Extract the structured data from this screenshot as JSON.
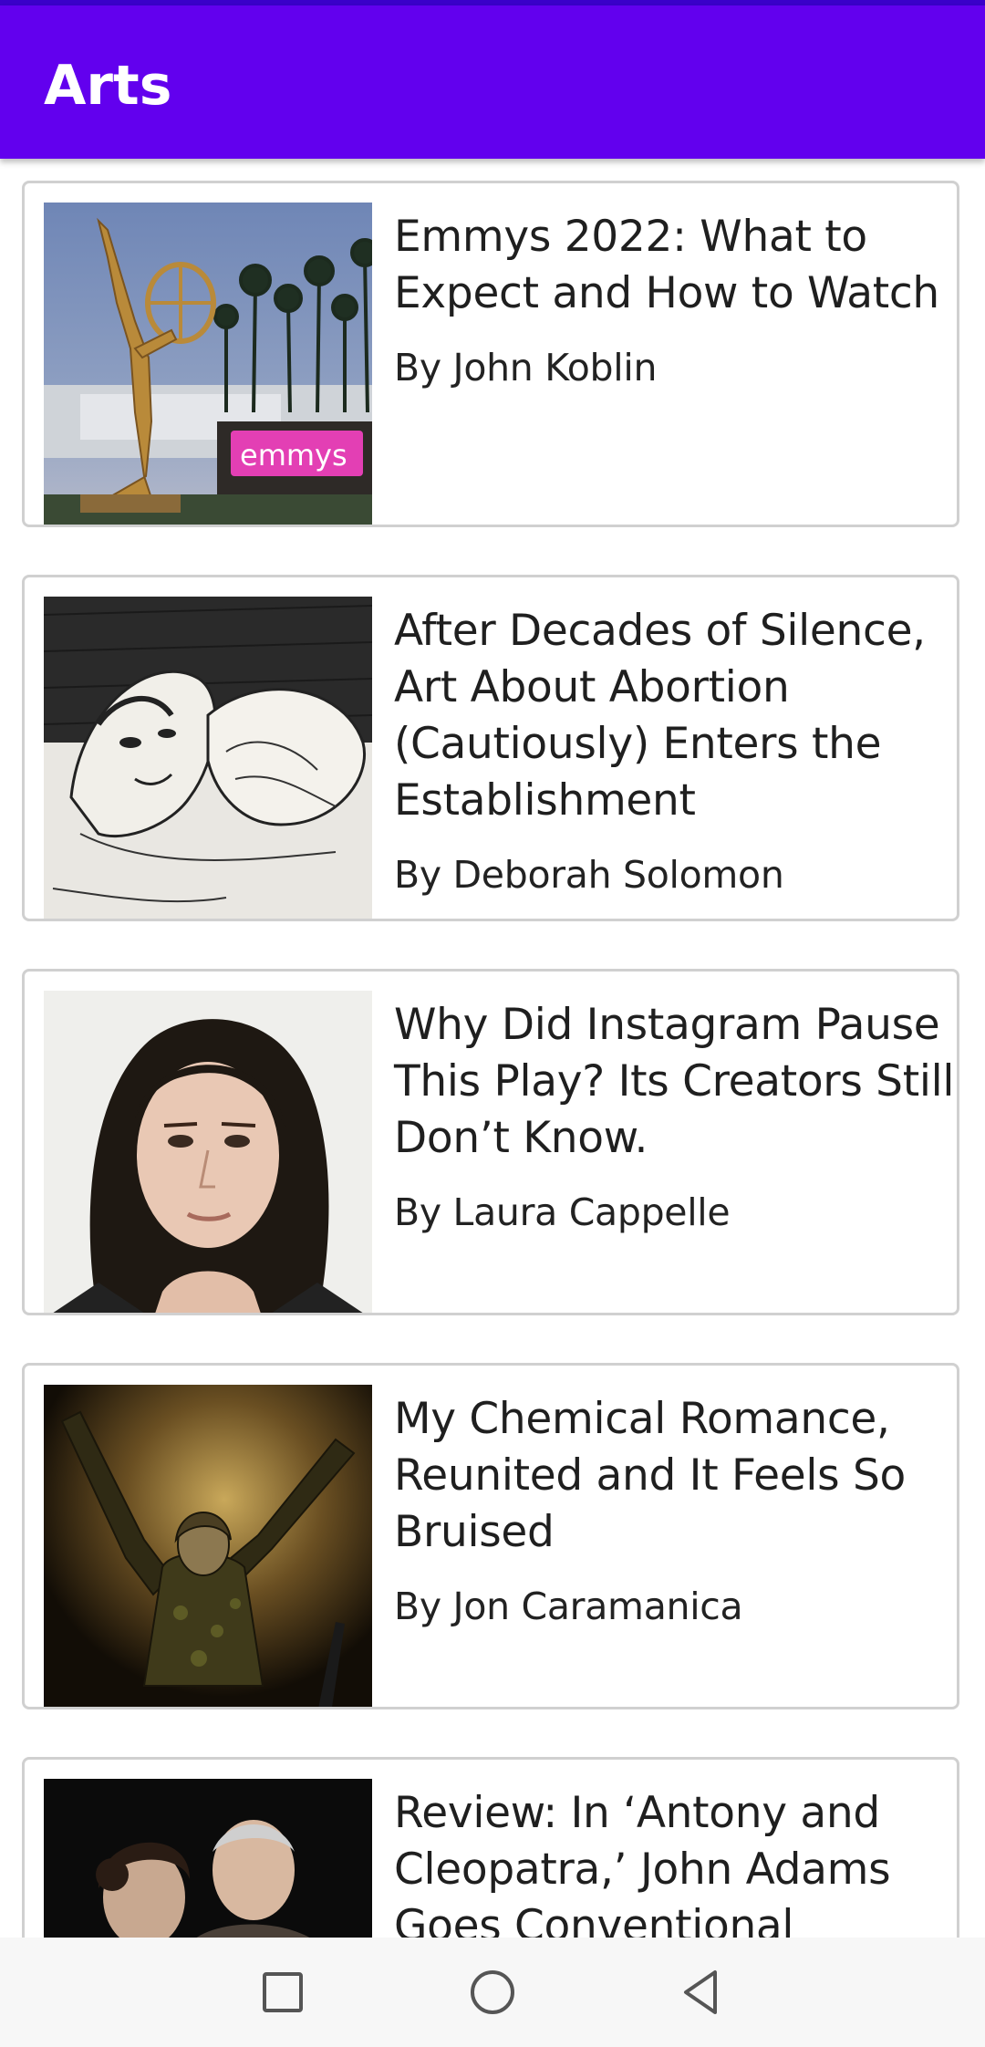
{
  "app_bar": {
    "title": "Arts",
    "color": "#6200ee"
  },
  "articles": [
    {
      "title": "Emmys 2022: What to Expect and How to Watch",
      "byline": "By John Koblin",
      "image_icon": "emmy-statue-photo"
    },
    {
      "title": "After Decades of Silence, Art About Abortion (Cautiously) Enters the Establishment",
      "byline": "By Deborah Solomon",
      "image_icon": "sketch-artwork-photo"
    },
    {
      "title": "Why Did Instagram Pause This Play? Its Creators Still Don’t Know.",
      "byline": "By Laura Cappelle",
      "image_icon": "portrait-photo"
    },
    {
      "title": "My Chemical Romance, Reunited and It Feels So Bruised",
      "byline": "By Jon Caramanica",
      "image_icon": "concert-performer-photo"
    },
    {
      "title": "Review: In ‘Antony and Cleopatra,’ John Adams Goes Conventional",
      "byline": "",
      "image_icon": "opera-singers-photo"
    }
  ],
  "nav_bar": {
    "icons": [
      "recents-square-icon",
      "home-circle-icon",
      "back-triangle-icon"
    ]
  }
}
